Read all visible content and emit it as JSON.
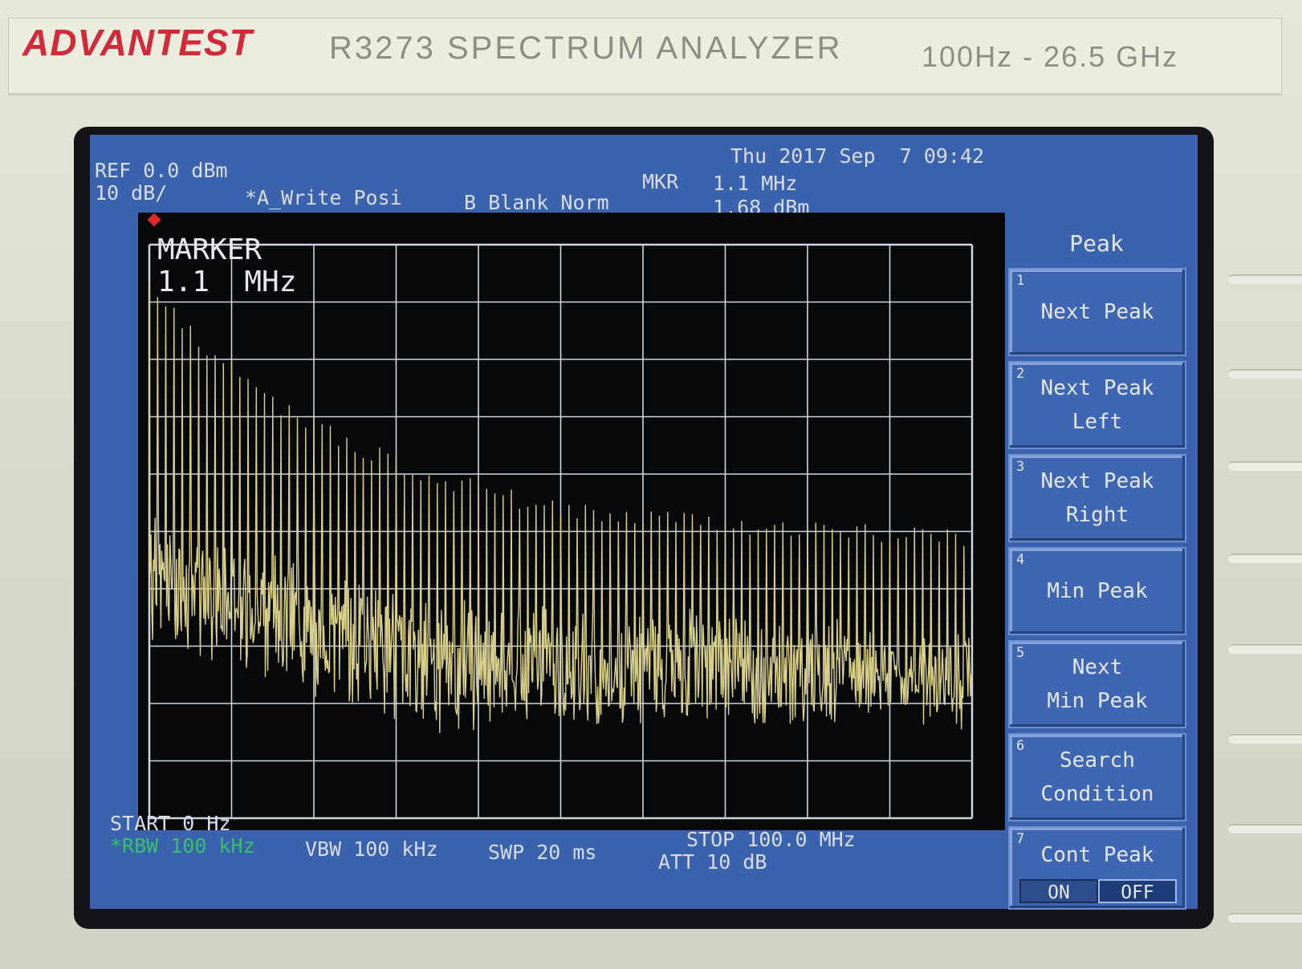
{
  "header": {
    "brand": "ADVANTEST",
    "model": "R3273  SPECTRUM  ANALYZER",
    "range": "100Hz - 26.5 GHz"
  },
  "status": {
    "datetime": "Thu 2017 Sep  7 09:42",
    "ref": "REF 0.0 dBm",
    "scale": "10 dB/",
    "trace_a": "*A_Write Posi",
    "trace_b": "B_Blank Norm",
    "mkr_label": "MKR",
    "mkr_freq": "1.1 MHz",
    "mkr_level": "1.68 dBm"
  },
  "plot": {
    "marker_title": "MARKER",
    "marker_value": "1.1  MHz"
  },
  "footer": {
    "start": "START 0 Hz",
    "rbw": "*RBW 100 kHz",
    "vbw": "VBW 100 kHz",
    "swp": "SWP 20 ms",
    "stop": "STOP 100.0 MHz",
    "att": "ATT 10 dB"
  },
  "softkeys": {
    "title": "Peak",
    "items": [
      {
        "num": "1",
        "label": "Next Peak"
      },
      {
        "num": "2",
        "label": "Next Peak\nLeft"
      },
      {
        "num": "3",
        "label": "Next Peak\nRight"
      },
      {
        "num": "4",
        "label": "Min Peak"
      },
      {
        "num": "5",
        "label": "Next\nMin Peak"
      },
      {
        "num": "6",
        "label": "Search\nCondition"
      },
      {
        "num": "7",
        "label": "Cont Peak"
      }
    ],
    "on_label": "ON",
    "off_label": "OFF"
  },
  "colors": {
    "screen_bg": "#3b62ad",
    "trace": "#d8cf8a",
    "grid": "#d0d4dc",
    "brand": "#d12a3a"
  }
}
